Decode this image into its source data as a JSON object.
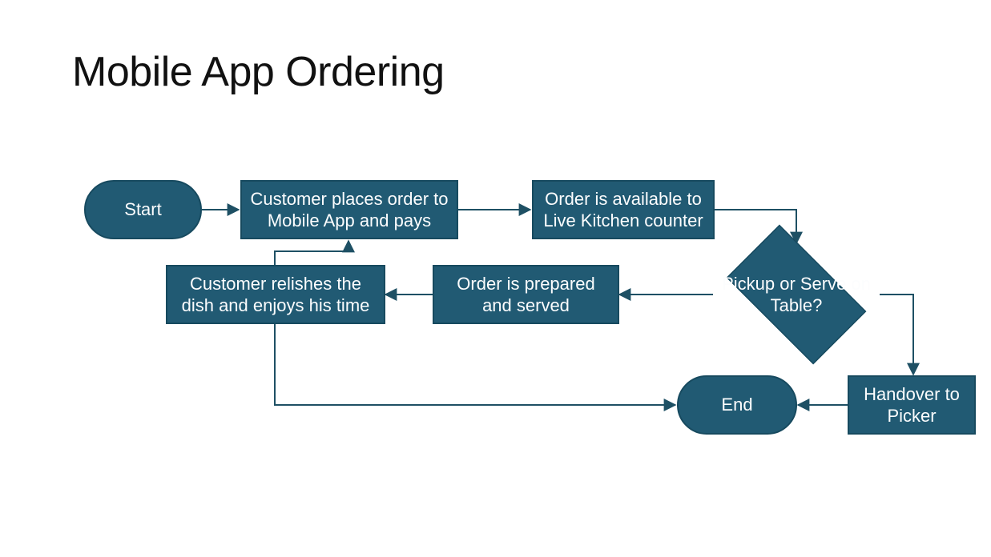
{
  "title": "Mobile App Ordering",
  "nodes": {
    "start": {
      "label": "Start"
    },
    "place_order": {
      "label": "Customer places order to Mobile App and pays"
    },
    "kitchen": {
      "label": "Order is available to Live Kitchen counter"
    },
    "decision": {
      "label": "Pickup or Serve on Table?"
    },
    "prepared": {
      "label": "Order is prepared and served"
    },
    "relishes": {
      "label": "Customer relishes the dish and enjoys  his time"
    },
    "handover": {
      "label": "Handover to Picker"
    },
    "end": {
      "label": "End"
    }
  },
  "colors": {
    "node_fill": "#215a73",
    "node_stroke": "#174a5f",
    "connector": "#1e5064"
  },
  "chart_data": {
    "type": "flowchart",
    "title": "Mobile App Ordering",
    "nodes": [
      {
        "id": "start",
        "shape": "terminator",
        "label": "Start"
      },
      {
        "id": "place_order",
        "shape": "process",
        "label": "Customer places order to Mobile App and pays"
      },
      {
        "id": "kitchen",
        "shape": "process",
        "label": "Order is available to Live Kitchen counter"
      },
      {
        "id": "decision",
        "shape": "decision",
        "label": "Pickup or Serve on Table?"
      },
      {
        "id": "prepared",
        "shape": "process",
        "label": "Order is prepared and served"
      },
      {
        "id": "relishes",
        "shape": "process",
        "label": "Customer relishes the dish and enjoys  his time"
      },
      {
        "id": "handover",
        "shape": "process",
        "label": "Handover to Picker"
      },
      {
        "id": "end",
        "shape": "terminator",
        "label": "End"
      }
    ],
    "edges": [
      {
        "from": "start",
        "to": "place_order"
      },
      {
        "from": "place_order",
        "to": "kitchen"
      },
      {
        "from": "kitchen",
        "to": "decision"
      },
      {
        "from": "decision",
        "to": "prepared"
      },
      {
        "from": "prepared",
        "to": "relishes"
      },
      {
        "from": "relishes",
        "to": "place_order"
      },
      {
        "from": "relishes",
        "to": "end"
      },
      {
        "from": "decision",
        "to": "handover"
      },
      {
        "from": "handover",
        "to": "end"
      }
    ]
  }
}
